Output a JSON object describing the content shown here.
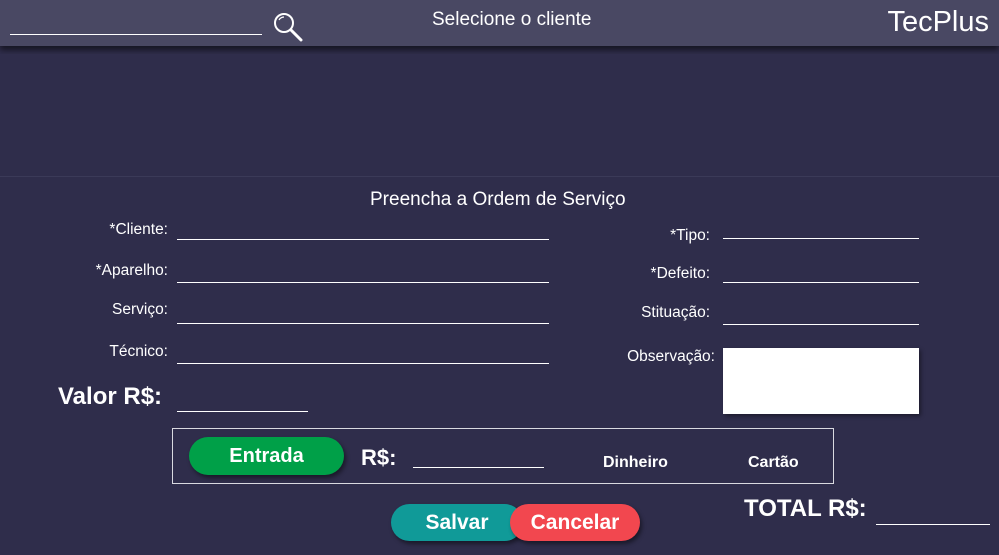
{
  "header": {
    "title": "Selecione o cliente",
    "brand": "TecPlus",
    "search_icon": "magnifier-icon"
  },
  "form": {
    "title": "Preencha a Ordem de Serviço",
    "left_fields": [
      {
        "label": "*Cliente:",
        "value": ""
      },
      {
        "label": "*Aparelho:",
        "value": ""
      },
      {
        "label": "Serviço:",
        "value": ""
      },
      {
        "label": "Técnico:",
        "value": ""
      }
    ],
    "right_fields": [
      {
        "label": "*Tipo:",
        "value": ""
      },
      {
        "label": "*Defeito:",
        "value": ""
      },
      {
        "label": "Stituação:",
        "value": ""
      },
      {
        "label": "Observação:",
        "value": ""
      }
    ],
    "valor_label": "Valor R$:",
    "valor_value": ""
  },
  "payment": {
    "entrada_label": "Entrada",
    "currency_label": "R$:",
    "amount_value": "",
    "options": [
      "Dinheiro",
      "Cartão"
    ]
  },
  "actions": {
    "save_label": "Salvar",
    "cancel_label": "Cancelar"
  },
  "total": {
    "label": "TOTAL R$:",
    "value": ""
  },
  "colors": {
    "background": "#2f2d4b",
    "topbar": "#494863",
    "entrada": "#00a048",
    "salvar": "#109a98",
    "cancelar": "#f2474f"
  }
}
